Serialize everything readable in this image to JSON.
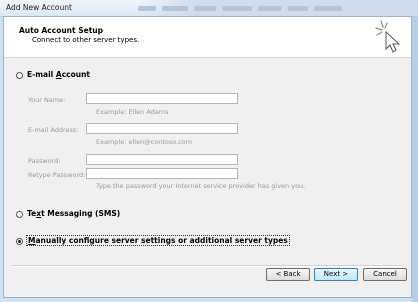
{
  "window": {
    "title": "Add New Account"
  },
  "header": {
    "title": "Auto Account Setup",
    "subtitle": "Connect to other server types."
  },
  "email_option": {
    "label_pre": "E-mail ",
    "label_ul": "A",
    "label_post": "ccount",
    "selected": false
  },
  "form": {
    "name_label": "Your Name:",
    "name_value": "",
    "name_hint": "Example: Ellen Adams",
    "email_label": "E-mail Address:",
    "email_value": "",
    "email_hint": "Example: ellen@contoso.com",
    "password_label": "Password:",
    "retype_label": "Retype Password:",
    "password_hint": "Type the password your Internet service provider has given you."
  },
  "sms_option": {
    "label_pre": "Te",
    "label_ul": "x",
    "label_post": "t Messaging (SMS)",
    "selected": false
  },
  "manual_option": {
    "label_pre": "",
    "label_ul": "M",
    "label_post": "anually configure server settings or additional server types",
    "selected": true
  },
  "buttons": {
    "back": "< Back",
    "next": "Next >",
    "cancel": "Cancel"
  }
}
